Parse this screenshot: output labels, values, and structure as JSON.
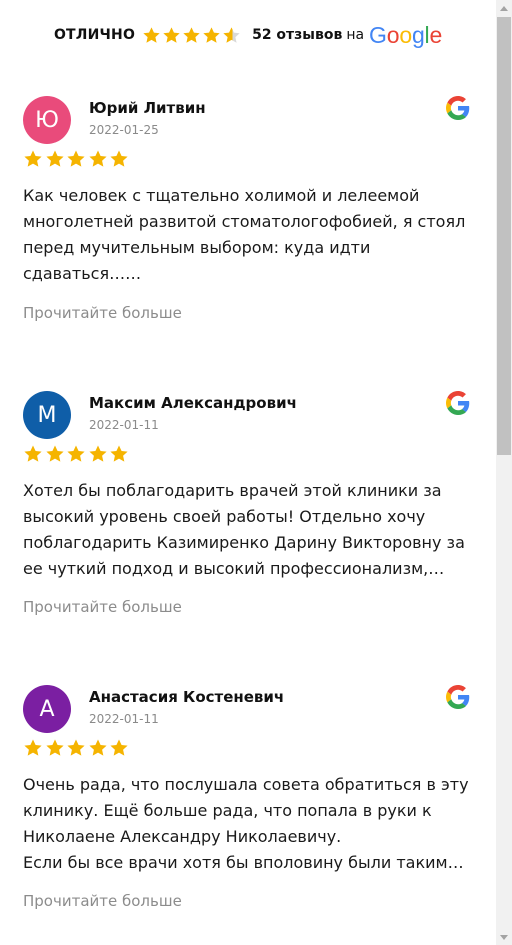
{
  "header": {
    "rating_word": "ОТЛИЧНО",
    "rating_stars": 4.6,
    "review_count": "52 отзывов",
    "on_word": "на",
    "google_letters": [
      "G",
      "o",
      "o",
      "g",
      "l",
      "e"
    ]
  },
  "colors": {
    "star": "#f5b400",
    "star_empty": "#d9d9d9",
    "avatar_yu": "#e94b7b",
    "avatar_m": "#0f5ea8",
    "avatar_a": "#7b1fa2"
  },
  "reviews": [
    {
      "initial": "Ю",
      "name": "Юрий Литвин",
      "date": "2022-01-25",
      "stars": 5,
      "source_icon": "google-icon",
      "text": [
        "Как человек с тщательно холимой и лелеемой многолетней развитой стоматологофобией, я стоял перед мучительным выбором: куда идти сдаваться……"
      ],
      "more": "Прочитайте больше"
    },
    {
      "initial": "М",
      "name": "Максим Александрович",
      "date": "2022-01-11",
      "stars": 5,
      "source_icon": "google-icon",
      "text": [
        "Хотел бы поблагодарить врачей этой клиники за высокий уровень своей работы! Отдельно хочу поблагодарить Казимиренко Дарину Викторовну за ее чуткий подход и высокий профессионализм,…"
      ],
      "more": "Прочитайте больше"
    },
    {
      "initial": "А",
      "name": "Анастасия Костеневич",
      "date": "2022-01-11",
      "stars": 5,
      "source_icon": "google-icon",
      "text": [
        "Очень рада, что послушала совета обратиться в эту клинику. Ещё больше рада, что попала в руки к Николаене Александру Николаевичу.",
        "Если бы все врачи хотя бы вполовину были таким…"
      ],
      "more": "Прочитайте больше"
    }
  ]
}
